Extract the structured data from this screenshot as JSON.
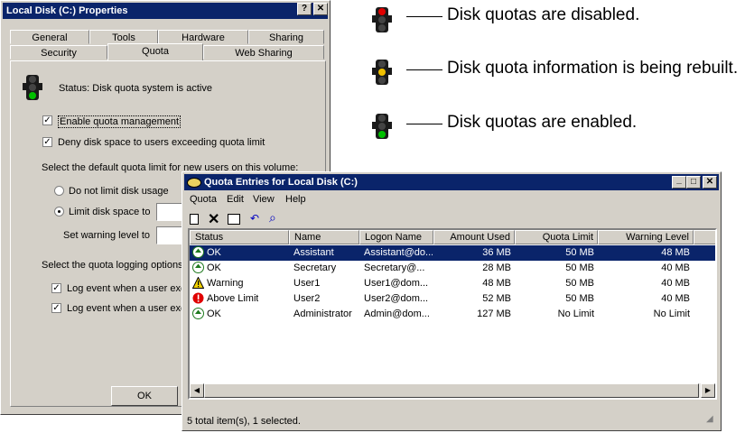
{
  "properties": {
    "title": "Local Disk (C:) Properties",
    "help_btn": "?",
    "close_btn": "✕",
    "tabs_back": [
      "General",
      "Tools",
      "Hardware",
      "Sharing"
    ],
    "tabs_front": [
      "Security",
      "Quota",
      "Web Sharing"
    ],
    "status": "Status:  Disk quota system is active",
    "enable_quota": "Enable quota management",
    "deny_space": "Deny disk space to users exceeding quota limit",
    "select_default": "Select the default quota limit for new users on this volume:",
    "no_limit": "Do not limit disk usage",
    "limit_space": "Limit disk space to",
    "warning_level": "Set warning level to",
    "logging_options": "Select the quota logging options",
    "log_event_1": "Log event when a user exc",
    "log_event_2": "Log event when a user exc",
    "ok_btn": "OK"
  },
  "legend": {
    "disabled": "Disk quotas are disabled.",
    "rebuilding": "Disk quota information is being rebuilt.",
    "enabled": "Disk quotas are enabled."
  },
  "entries": {
    "title": "Quota Entries for Local Disk (C:)",
    "min_btn": "_",
    "max_btn": "□",
    "close_btn": "✕",
    "menu": [
      "Quota",
      "Edit",
      "View",
      "Help"
    ],
    "columns": [
      "Status",
      "Name",
      "Logon Name",
      "Amount Used",
      "Quota Limit",
      "Warning Level"
    ],
    "rows": [
      {
        "status": "OK",
        "name": "Assistant",
        "logon": "Assistant@do...",
        "used": "36 MB",
        "limit": "50 MB",
        "warn": "48 MB"
      },
      {
        "status": "OK",
        "name": "Secretary",
        "logon": "Secretary@...",
        "used": "28 MB",
        "limit": "50 MB",
        "warn": "40 MB"
      },
      {
        "status": "Warning",
        "name": "User1",
        "logon": "User1@dom...",
        "used": "48 MB",
        "limit": "50 MB",
        "warn": "40 MB"
      },
      {
        "status": "Above Limit",
        "name": "User2",
        "logon": "User2@dom...",
        "used": "52 MB",
        "limit": "50 MB",
        "warn": "40 MB"
      },
      {
        "status": "OK",
        "name": "Administrator",
        "logon": "Admin@dom...",
        "used": "127 MB",
        "limit": "No Limit",
        "warn": "No Limit"
      }
    ],
    "statusbar": "5 total item(s), 1 selected."
  },
  "colors": {
    "title_bar": "#0a246a",
    "face": "#d4d0c8",
    "red": "#e00000",
    "amber": "#f0c000",
    "green": "#00c000"
  }
}
